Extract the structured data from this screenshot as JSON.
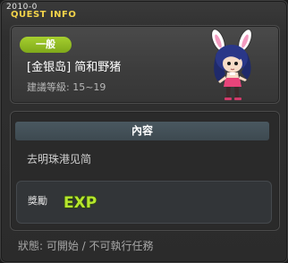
{
  "window": {
    "top_text": "2010-0",
    "title": "QUEST INFO"
  },
  "quest": {
    "badge_label": "一般",
    "name": "[金银岛] 简和野猪",
    "level_text": "建議等級: 15~19",
    "npc_icon": "npc-bunny-girl-icon"
  },
  "content": {
    "header": "內容",
    "description": "去明珠港见简"
  },
  "reward": {
    "label": "獎勵",
    "exp_text": "EXP",
    "exp_icon": "exp-icon"
  },
  "footer": {
    "status": "狀態: 可開始 / 不可執行任務"
  },
  "colors": {
    "title": "#f2d34a",
    "badge": "#8fb623",
    "exp_fill": "#b6e62d"
  }
}
